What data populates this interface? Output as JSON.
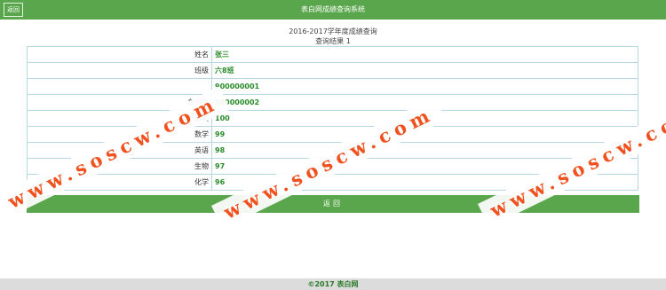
{
  "header": {
    "back_label": "返回",
    "title": "表白网成绩查询系统"
  },
  "heading": {
    "term": "2016-2017学年度成绩查询",
    "result": "查询结果 1"
  },
  "rows": [
    {
      "label": "姓名",
      "value": "张三"
    },
    {
      "label": "班级",
      "value": "六8班"
    },
    {
      "label": "",
      "value": "900000001"
    },
    {
      "label": "身份证",
      "value": "900000002"
    },
    {
      "label": "语文",
      "value": "100"
    },
    {
      "label": "数学",
      "value": "99"
    },
    {
      "label": "英语",
      "value": "98"
    },
    {
      "label": "生物",
      "value": "97"
    },
    {
      "label": "化学",
      "value": "96"
    }
  ],
  "return_label": "返回",
  "footer": "©2017 表白网",
  "watermark": "www.soscw.com",
  "colors": {
    "brand_green": "#5aa64c",
    "value_green": "#2a8a2a",
    "watermark_orange": "#f0521f"
  }
}
